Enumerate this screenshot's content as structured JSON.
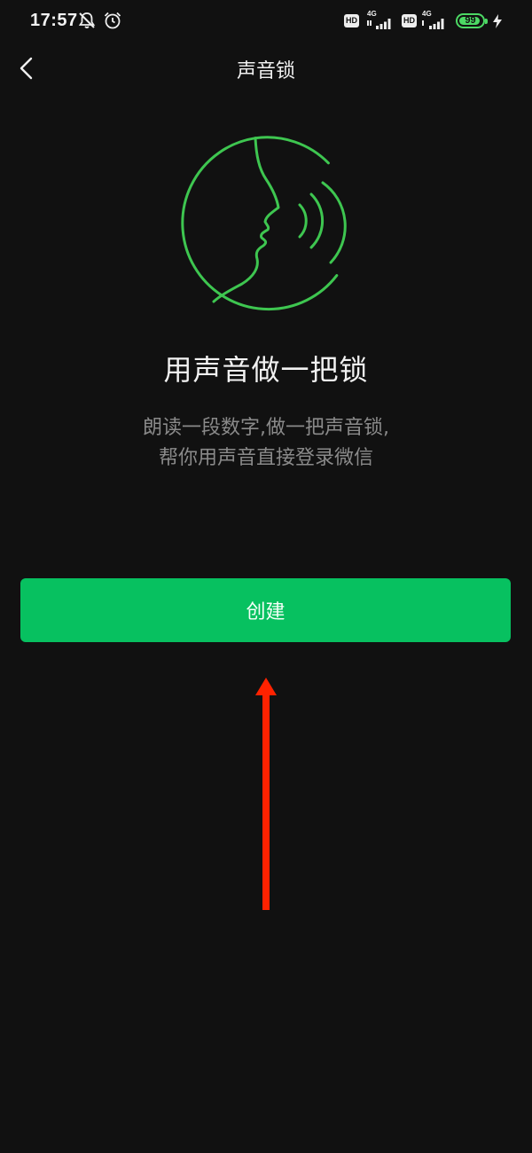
{
  "status_bar": {
    "time": "17:57",
    "network_1": "4G",
    "network_2": "4G",
    "hd_label": "HD",
    "battery": "99",
    "icons": [
      "notification-muted-icon",
      "alarm-icon",
      "signal-icon",
      "battery-icon",
      "charging-icon"
    ]
  },
  "header": {
    "title": "声音锁",
    "back_icon": "chevron-left-icon"
  },
  "illustration": {
    "icon": "voice-face-icon",
    "accent_color": "#3ec650"
  },
  "main": {
    "headline": "用声音做一把锁",
    "description_line1": "朗读一段数字,做一把声音锁,",
    "description_line2": "帮你用声音直接登录微信"
  },
  "actions": {
    "create_label": "创建",
    "create_color": "#07c160"
  },
  "annotation": {
    "arrow_color": "#ff2200",
    "icon": "arrow-up-icon"
  }
}
